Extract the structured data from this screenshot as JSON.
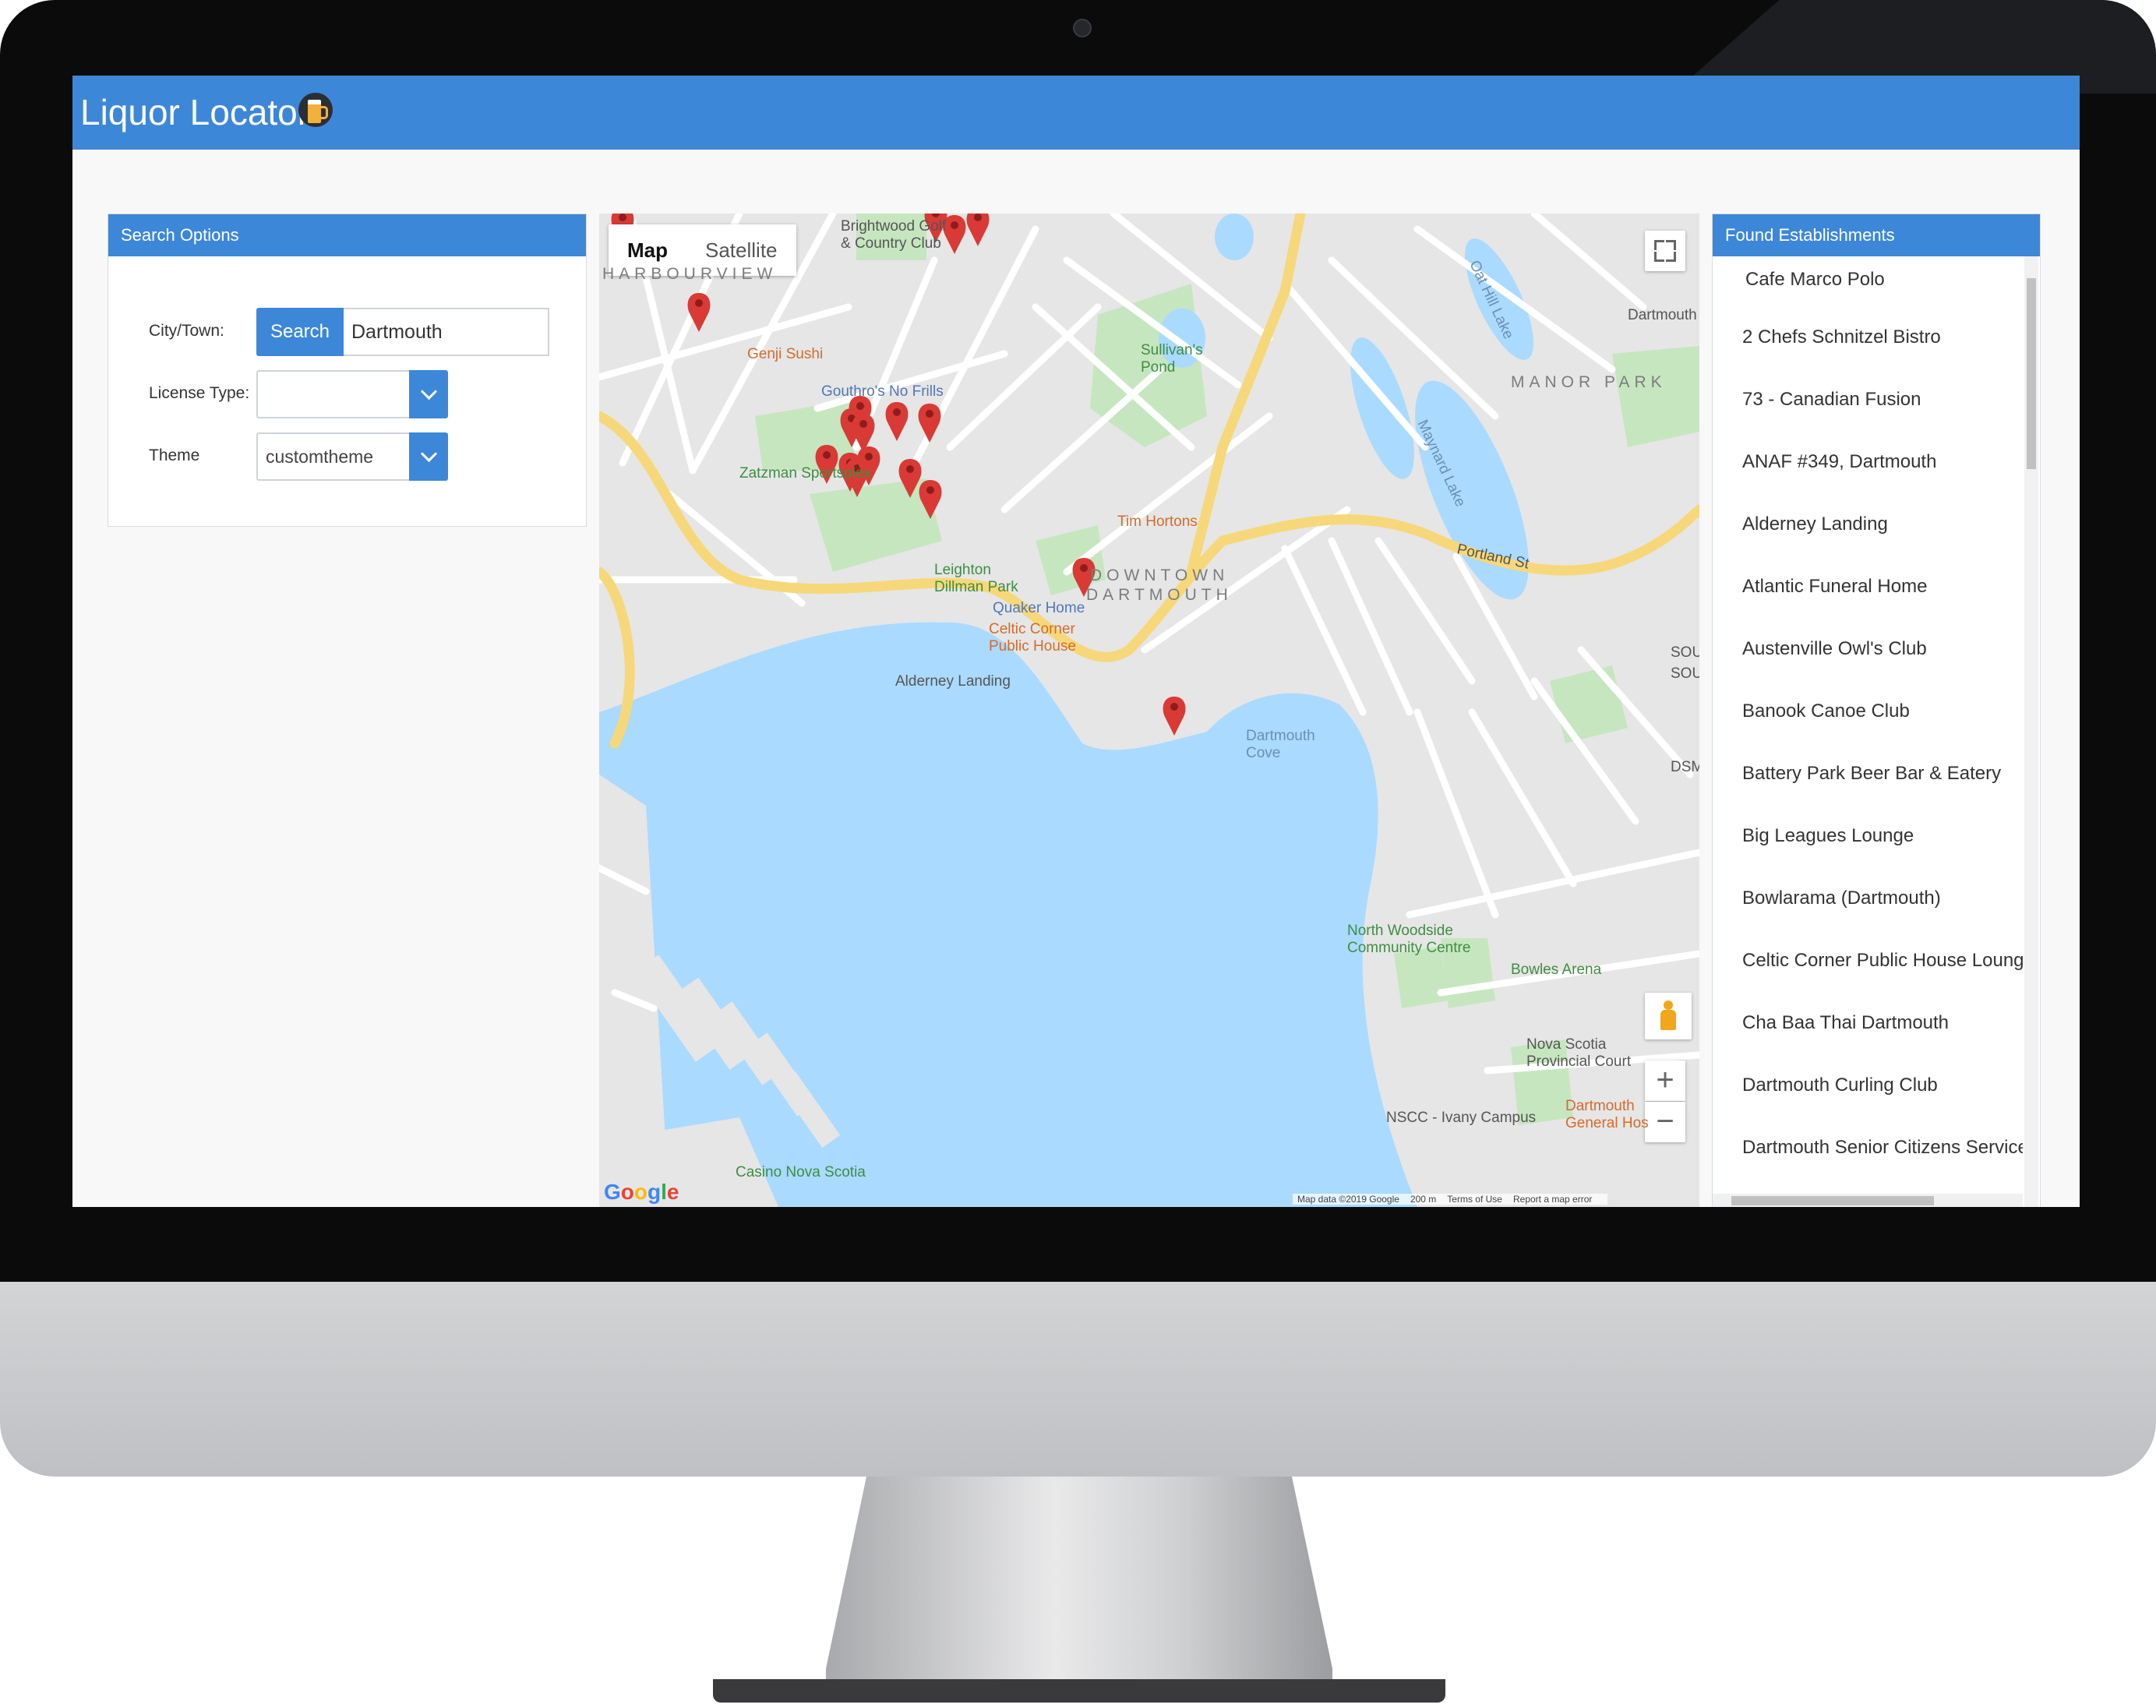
{
  "app": {
    "title": "Liquor Locator",
    "icon": "beer-mug-icon",
    "brand_color": "#3d87d8"
  },
  "search_panel": {
    "header": "Search Options",
    "city_label": "City/Town:",
    "search_button": "Search",
    "city_value": "Dartmouth",
    "license_label": "License Type:",
    "license_value": "",
    "theme_label": "Theme",
    "theme_value": "customtheme"
  },
  "map": {
    "map_tab": "Map",
    "satellite_tab": "Satellite",
    "active_tab": "Map",
    "zoom_in": "+",
    "zoom_out": "−",
    "google": "Google",
    "attribution": [
      "Map data ©2019 Google",
      "200 m",
      "Terms of Use",
      "Report a map error"
    ],
    "marker_color": "#d93a35",
    "water_color": "#aadaff",
    "labels": {
      "brightwood": "Brightwood Golf\n& Country Club",
      "harbourview": "HARBOURVIEW",
      "genji": "Genji Sushi",
      "gouthro": "Gouthro's No Frills",
      "zatzman": "Zatzman Sportsplex",
      "sullivans": "Sullivan's\nPond",
      "manor_park": "MANOR PARK",
      "dartmouth_tr": "Dartmouth",
      "tim_hortons": "Tim Hortons",
      "downtown1": "DOWNTOWN",
      "downtown2": "DARTMOUTH",
      "leighton": "Leighton\nDillman Park",
      "quaker": "Quaker Home",
      "celtic": "Celtic Corner\nPublic House",
      "alderney": "Alderney Landing",
      "portland": "Portland St",
      "dartmouth_cove": "Dartmouth\nCove",
      "dsm": "DSM",
      "south": "SOU",
      "north_woodside": "North Woodside\nCommunity Centre",
      "bowles": "Bowles Arena",
      "ns_court": "Nova Scotia\nProvincial Court",
      "nscc": "NSCC - Ivany Campus",
      "dartmouth_general": "Dartmouth\nGeneral Hos",
      "casino": "Casino Nova Scotia",
      "maynard": "Maynard Lake",
      "oat_hill": "Oat Hill Lake"
    }
  },
  "results": {
    "header": "Found Establishments",
    "items": [
      "Cafe Marco Polo",
      "2 Chefs Schnitzel Bistro",
      "73 - Canadian Fusion",
      "ANAF #349, Dartmouth",
      "Alderney Landing",
      "Atlantic Funeral Home",
      "Austenville Owl's Club",
      "Banook Canoe Club",
      "Battery Park Beer Bar & Eatery",
      "Big Leagues Lounge",
      "Bowlarama (Dartmouth)",
      "Celtic Corner Public House Lounge",
      "Cha Baa Thai Dartmouth",
      "Dartmouth Curling Club",
      "Dartmouth Senior Citizens Service C"
    ]
  }
}
